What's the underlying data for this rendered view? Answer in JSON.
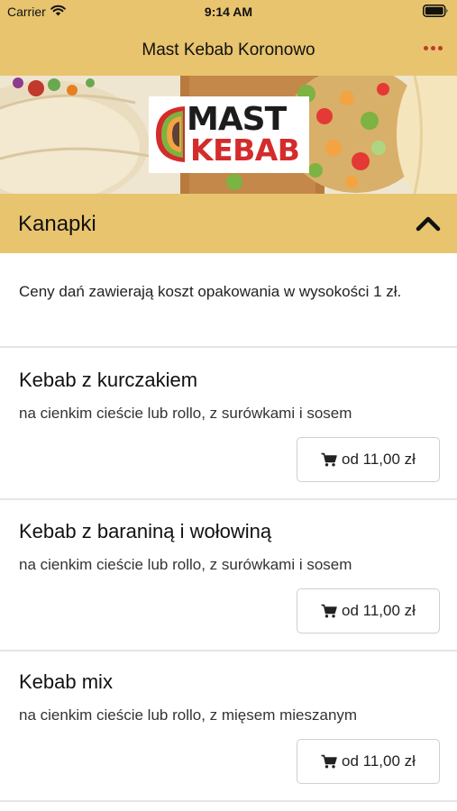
{
  "status": {
    "carrier": "Carrier",
    "time": "9:14 AM"
  },
  "header": {
    "title": "Mast Kebab Koronowo"
  },
  "logo": {
    "line1": "MAST",
    "line2": "KEBAB"
  },
  "category": {
    "title": "Kanapki"
  },
  "notice": "Ceny dań zawierają koszt opakowania w wysokości 1 zł.",
  "items": [
    {
      "name": "Kebab z kurczakiem",
      "description": "na cienkim cieście lub rollo, z surówkami i sosem",
      "price": "od 11,00 zł"
    },
    {
      "name": "Kebab z baraniną i wołowiną",
      "description": "na cienkim cieście lub rollo, z surówkami i sosem",
      "price": "od 11,00 zł"
    },
    {
      "name": "Kebab mix",
      "description": "na cienkim cieście lub rollo, z mięsem mieszanym",
      "price": "od 11,00 zł"
    }
  ],
  "colors": {
    "header_bg": "#e8c46f",
    "accent_red": "#c0392b",
    "divider": "#e6e6e6"
  },
  "icons": [
    "wifi-icon",
    "battery-icon",
    "more-icon",
    "chevron-up-icon",
    "cart-icon"
  ]
}
